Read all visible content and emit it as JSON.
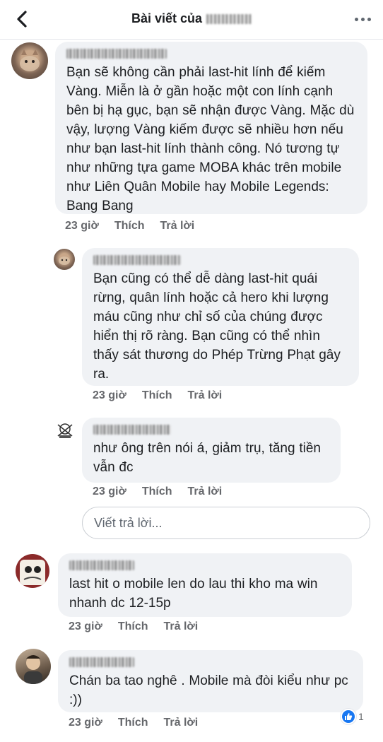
{
  "header": {
    "title": "Bài viết của",
    "author_name": "[blurred]"
  },
  "comments": [
    {
      "author": "[blurred]",
      "text": "Bạn sẽ không cần phải last-hit lính để kiếm Vàng. Miễn là ở gần hoặc một con lính cạnh bên bị hạ gục, bạn sẽ nhận được Vàng. Mặc dù vậy, lượng Vàng kiếm được sẽ nhiều hơn nếu như bạn last-hit lính thành công. Nó tương tự như những tựa game MOBA khác trên mobile như Liên Quân Mobile hay Mobile Legends: Bang Bang",
      "time": "23 giờ",
      "like": "Thích",
      "reply": "Trả lời"
    },
    {
      "author": "[blurred]",
      "text": "Bạn cũng có thể dễ dàng last-hit quái rừng, quân lính hoặc cả hero khi lượng máu cũng như chỉ số của chúng được hiển thị rõ ràng. Bạn cũng có thể nhìn thấy sát thương do Phép Trừng Phạt gây ra.",
      "time": "23 giờ",
      "like": "Thích",
      "reply": "Trả lời"
    },
    {
      "author": "[blurred]",
      "text": "như ông trên nói á, giảm trụ, tăng tiền vẫn đc",
      "time": "23 giờ",
      "like": "Thích",
      "reply": "Trả lời"
    },
    {
      "author": "[blurred]",
      "text": "last hit o mobile len do lau thi kho ma win nhanh dc 12-15p",
      "time": "23 giờ",
      "like": "Thích",
      "reply": "Trả lời"
    },
    {
      "author": "[blurred]",
      "text": "Chán ba tao nghê . Mobile mà đòi kiểu như pc :))",
      "time": "23 giờ",
      "like": "Thích",
      "reply": "Trả lời",
      "reaction_count": "1"
    }
  ],
  "reply_input": {
    "placeholder": "Viết trả lời..."
  },
  "icons": {
    "back": "chevron-left-icon",
    "more": "more-horizontal-icon",
    "like": "thumbs-up-icon"
  },
  "colors": {
    "accent": "#1877f2",
    "bubble": "#f0f2f5",
    "meta": "#65676b"
  }
}
